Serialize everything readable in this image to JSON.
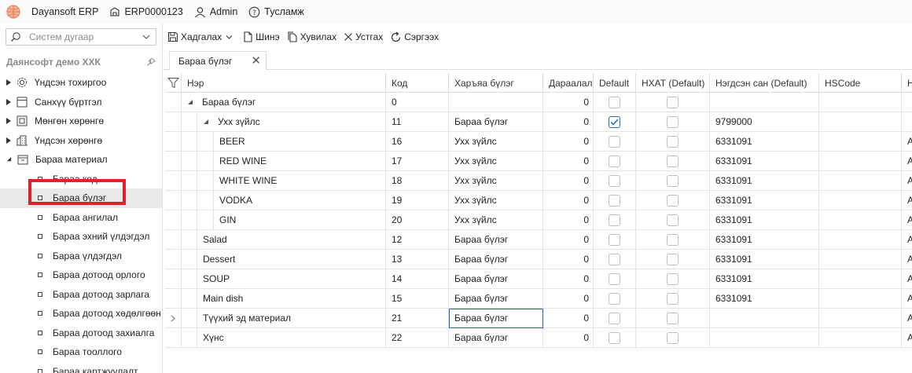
{
  "topbar": {
    "app_name": "Dayansoft ERP",
    "db_code": "ERP0000123",
    "user": "Admin",
    "help": "Тусламж"
  },
  "sidebar": {
    "search_placeholder": "Систем дугаар",
    "company": "Даянсофт демо ХХК",
    "groups": [
      {
        "label": "Үндсэн тохиргоо",
        "icon": "gear-icon"
      },
      {
        "label": "Санхүү бүртгэл",
        "icon": "ledger-icon"
      },
      {
        "label": "Мөнгөн хөрөнгө",
        "icon": "cash-icon"
      },
      {
        "label": "Үндсэн хөрөнгө",
        "icon": "building-icon"
      },
      {
        "label": "Бараа материал",
        "icon": "inventory-icon",
        "expanded": true
      }
    ],
    "children": [
      {
        "label": "Бараа код"
      },
      {
        "label": "Бараа бүлэг",
        "selected": true
      },
      {
        "label": "Бараа ангилал"
      },
      {
        "label": "Бараа эхний үлдэгдэл"
      },
      {
        "label": "Бараа үлдэгдэл"
      },
      {
        "label": "Бараа дотоод орлого"
      },
      {
        "label": "Бараа дотоод зарлага"
      },
      {
        "label": "Бараа дотоод хөдөлгөөн"
      },
      {
        "label": "Бараа дотоод захиалга"
      },
      {
        "label": "Бараа тооллого"
      },
      {
        "label": "Бараа картжуулалт"
      }
    ]
  },
  "toolbar": {
    "save": "Хадгалах",
    "new": "Шинэ",
    "copy": "Хувилах",
    "delete": "Устгах",
    "refresh": "Сэргээх"
  },
  "tab": {
    "label": "Бараа бүлэг"
  },
  "grid": {
    "columns": [
      "Нэр",
      "Код",
      "Харъяа бүлэг",
      "Дараалал",
      "Default",
      "НХАТ (Default)",
      "Нэгдсэн сан (Default)",
      "HSCode",
      "Н"
    ],
    "rows": [
      {
        "name": "Бараа бүлэг",
        "level": 0,
        "expanded": true,
        "code": "0",
        "parent": "",
        "order": "0",
        "default": false,
        "nhat": false,
        "fund": "",
        "hscode": "",
        "last": ""
      },
      {
        "name": "Ухх зүйлс",
        "level": 1,
        "expanded": true,
        "code": "11",
        "parent": "Бараа бүлэг",
        "order": "0",
        "default": true,
        "nhat": false,
        "fund": "9799000",
        "hscode": "",
        "last": ""
      },
      {
        "name": "BEER",
        "level": 2,
        "code": "16",
        "parent": "Ухх зүйлс",
        "order": "0",
        "default": false,
        "nhat": false,
        "fund": "6331091",
        "hscode": "",
        "last": "A"
      },
      {
        "name": "RED WINE",
        "level": 2,
        "code": "17",
        "parent": "Ухх зүйлс",
        "order": "0",
        "default": false,
        "nhat": false,
        "fund": "6331091",
        "hscode": "",
        "last": "A"
      },
      {
        "name": "WHITE WINE",
        "level": 2,
        "code": "18",
        "parent": "Ухх зүйлс",
        "order": "0",
        "default": false,
        "nhat": false,
        "fund": "6331091",
        "hscode": "",
        "last": "A"
      },
      {
        "name": "VODKA",
        "level": 2,
        "code": "19",
        "parent": "Ухх зүйлс",
        "order": "0",
        "default": false,
        "nhat": false,
        "fund": "6331091",
        "hscode": "",
        "last": "A"
      },
      {
        "name": "GIN",
        "level": 2,
        "code": "20",
        "parent": "Ухх зүйлс",
        "order": "0",
        "default": false,
        "nhat": false,
        "fund": "6331091",
        "hscode": "",
        "last": "A"
      },
      {
        "name": "Salad",
        "level": 1,
        "code": "12",
        "parent": "Бараа бүлэг",
        "order": "0",
        "default": false,
        "nhat": false,
        "fund": "6331091",
        "hscode": "",
        "last": "A"
      },
      {
        "name": "Dessert",
        "level": 1,
        "code": "13",
        "parent": "Бараа бүлэг",
        "order": "0",
        "default": false,
        "nhat": false,
        "fund": "6331091",
        "hscode": "",
        "last": "A"
      },
      {
        "name": "SOUP",
        "level": 1,
        "code": "14",
        "parent": "Бараа бүлэг",
        "order": "0",
        "default": false,
        "nhat": false,
        "fund": "6331091",
        "hscode": "",
        "last": "A"
      },
      {
        "name": "Main dish",
        "level": 1,
        "code": "15",
        "parent": "Бараа бүлэг",
        "order": "0",
        "default": false,
        "nhat": false,
        "fund": "6331091",
        "hscode": "",
        "last": "A"
      },
      {
        "name": "Түүхий эд материал",
        "level": 1,
        "code": "21",
        "parent": "Бараа бүлэг",
        "order": "0",
        "default": false,
        "nhat": false,
        "fund": "",
        "hscode": "",
        "last": "A",
        "current": true
      },
      {
        "name": "Хүнс",
        "level": 1,
        "code": "22",
        "parent": "Бараа бүлэг",
        "order": "0",
        "default": false,
        "nhat": false,
        "fund": "",
        "hscode": "",
        "last": "A"
      }
    ]
  },
  "colors": {
    "accent": "#1f6fc5",
    "highlight": "#e3202b",
    "selected_bg": "#e9e9e9"
  }
}
